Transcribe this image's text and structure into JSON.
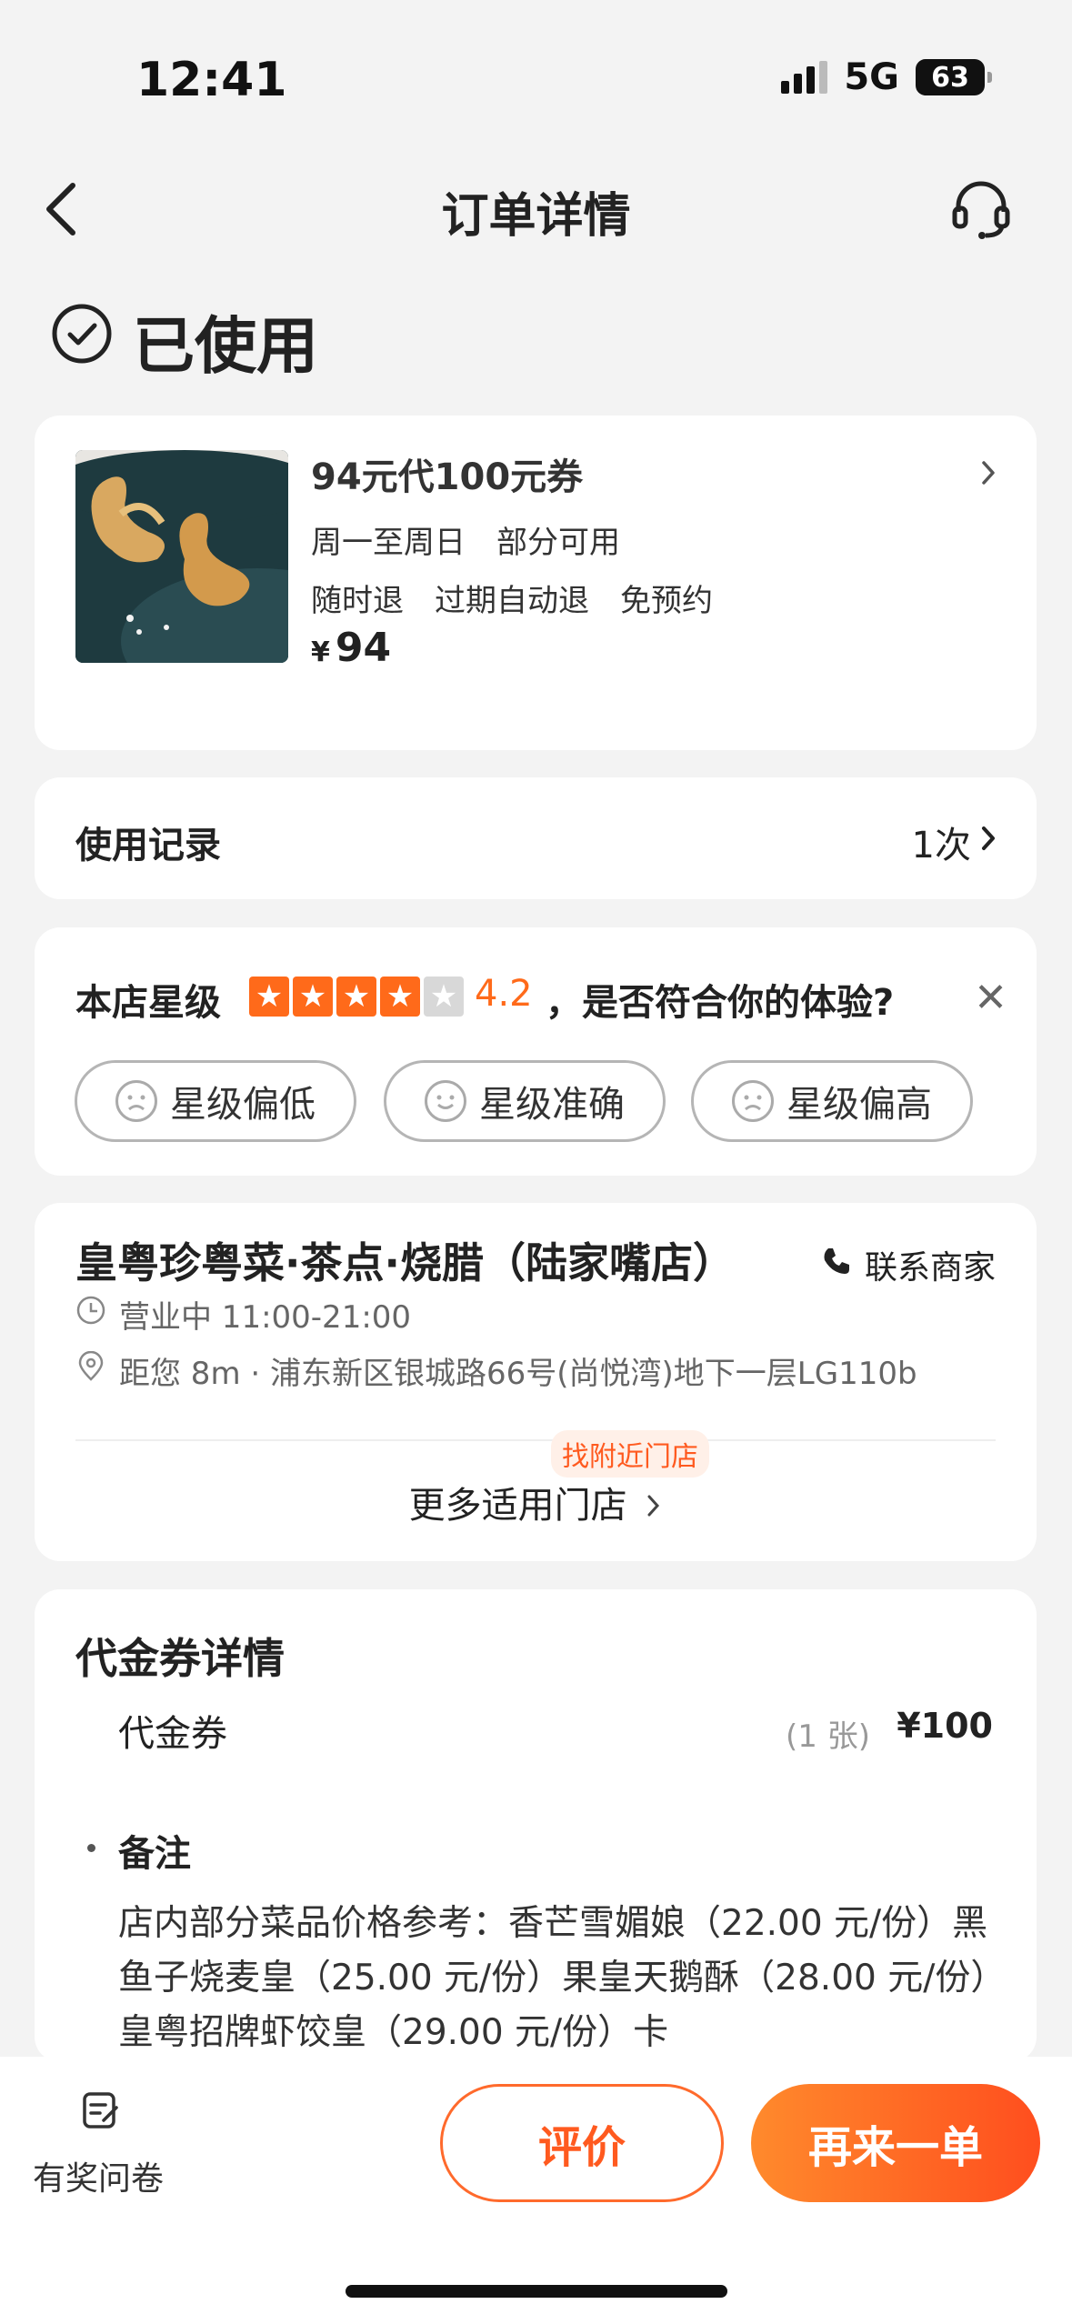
{
  "status_bar": {
    "time": "12:41",
    "network": "5G",
    "battery": "63"
  },
  "nav": {
    "title": "订单详情",
    "back_icon": "back-chevron-icon",
    "service_icon": "headset-icon"
  },
  "order_status": {
    "label": "已使用",
    "icon": "check-circle-icon"
  },
  "deal": {
    "title": "94元代100元券",
    "line1": "周一至周日　部分可用",
    "line2": "随时退　过期自动退　免预约",
    "currency": "¥",
    "price": "94"
  },
  "usage": {
    "label": "使用记录",
    "value": "1次"
  },
  "rating": {
    "prefix": "本店星级",
    "stars_filled": 4,
    "stars_total": 5,
    "score": "4.2",
    "question": "，是否符合你的体验?",
    "options": [
      "星级偏低",
      "星级准确",
      "星级偏高"
    ],
    "star_color": "#ff6a1a"
  },
  "shop": {
    "name": "皇粤珍粤菜·茶点·烧腊（陆家嘴店）",
    "contact_label": "联系商家",
    "hours": "营业中 11:00-21:00",
    "address": "距您 8m · 浦东新区银城路66号(尚悦湾)地下一层LG110b",
    "nearby_badge": "找附近门店",
    "more_stores": "更多适用门店"
  },
  "voucher": {
    "section_title": "代金券详情",
    "item_name": "代金券",
    "quantity": "(1 张)",
    "price": "¥100",
    "note_title": "备注",
    "note_text": "店内部分菜品价格参考：香芒雪媚娘（22.00 元/份）黑鱼子烧麦皇（25.00 元/份）果皇天鹅酥（28.00 元/份）皇粤招牌虾饺皇（29.00 元/份）卡"
  },
  "bottom": {
    "survey_label": "有奖问卷",
    "review_label": "评价",
    "reorder_label": "再来一单"
  },
  "colors": {
    "accent": "#ff5a1f",
    "background": "#f3f3f3"
  }
}
